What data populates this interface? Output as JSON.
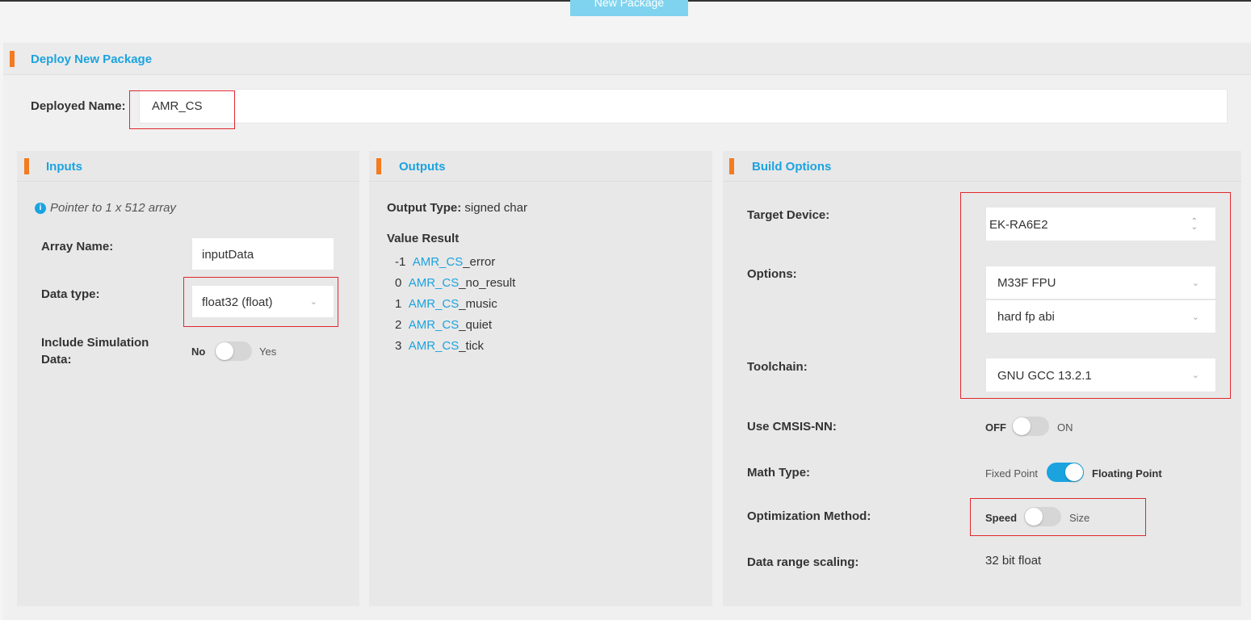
{
  "top_button": {
    "label": "New Package"
  },
  "deploy": {
    "title": "Deploy New Package",
    "name_label": "Deployed Name:",
    "name_value": "AMR_CS"
  },
  "inputs": {
    "title": "Inputs",
    "hint": "Pointer to 1 x 512 array",
    "array_name_label": "Array Name:",
    "array_name_value": "inputData",
    "data_type_label": "Data type:",
    "data_type_value": "float32 (float)",
    "sim_label_line1": "Include Simulation",
    "sim_label_line2": "Data:",
    "sim_off": "No",
    "sim_on": "Yes"
  },
  "outputs": {
    "title": "Outputs",
    "type_label": "Output Type:",
    "type_value": "signed char",
    "value_result_label": "Value Result",
    "rows": [
      {
        "num": "-1",
        "prefix": "AMR_CS",
        "suffix": "_error"
      },
      {
        "num": "0",
        "prefix": "AMR_CS",
        "suffix": "_no_result"
      },
      {
        "num": "1",
        "prefix": "AMR_CS",
        "suffix": "_music"
      },
      {
        "num": "2",
        "prefix": "AMR_CS",
        "suffix": "_quiet"
      },
      {
        "num": "3",
        "prefix": "AMR_CS",
        "suffix": "_tick"
      }
    ]
  },
  "build": {
    "title": "Build Options",
    "target_label": "Target Device:",
    "target_value": "EK-RA6E2",
    "options_label": "Options:",
    "option1_value": "M33F FPU",
    "option2_value": "hard fp abi",
    "toolchain_label": "Toolchain:",
    "toolchain_value": "GNU GCC 13.2.1",
    "cmsis_label": "Use CMSIS-NN:",
    "cmsis_off": "OFF",
    "cmsis_on": "ON",
    "math_label": "Math Type:",
    "math_off": "Fixed Point",
    "math_on": "Floating Point",
    "opt_label": "Optimization Method:",
    "opt_off": "Speed",
    "opt_on": "Size",
    "scaling_label": "Data range scaling:",
    "scaling_value": "32 bit float"
  },
  "colors": {
    "accent": "#f47b20",
    "title_blue": "#1ba3e0",
    "highlight": "#e0282e"
  }
}
